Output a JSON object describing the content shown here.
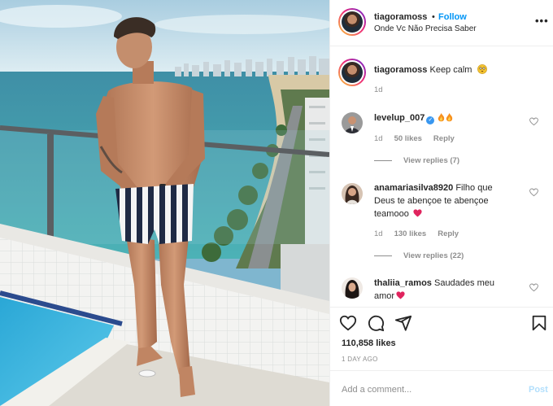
{
  "post": {
    "username": "tiagoramoss",
    "separator": "•",
    "follow_label": "Follow",
    "location": "Onde Vc Não Precisa Saber",
    "more_icon": "more-horizontal-icon",
    "caption": {
      "username": "tiagoramoss",
      "text": "Keep calm",
      "emoji": "flushed-face",
      "time": "1d"
    }
  },
  "comments": [
    {
      "username": "levelup_007",
      "verified": true,
      "text": "",
      "emoji": [
        "fire",
        "fire"
      ],
      "time": "1d",
      "likes": "50 likes",
      "reply": "Reply",
      "view_replies": "View replies (7)"
    },
    {
      "username": "anamariasilva8920",
      "verified": false,
      "text_line1": "Filho que",
      "text_line2": "Deus te abençoe te abençoe",
      "text_line3": "teamooo",
      "emoji": [
        "red-heart"
      ],
      "time": "1d",
      "likes": "130 likes",
      "reply": "Reply",
      "view_replies": "View replies (22)"
    },
    {
      "username": "thaliia_ramos",
      "verified": false,
      "text_line1": "Saudades meu",
      "text_line2": "amor",
      "emoji": [
        "red-heart"
      ]
    }
  ],
  "actions": {
    "like_icon": "heart-icon",
    "comment_icon": "comment-icon",
    "share_icon": "send-icon",
    "save_icon": "bookmark-icon",
    "likes_count": "110,858 likes",
    "time_ago": "1 DAY AGO"
  },
  "add_comment": {
    "placeholder": "Add a comment...",
    "post_label": "Post"
  },
  "colors": {
    "link_blue": "#0095f6",
    "post_disabled": "#b2dffc",
    "muted": "#8e8e8e",
    "text": "#262626",
    "verified_blue": "#3897f0",
    "heart_red": "#ed4956"
  }
}
